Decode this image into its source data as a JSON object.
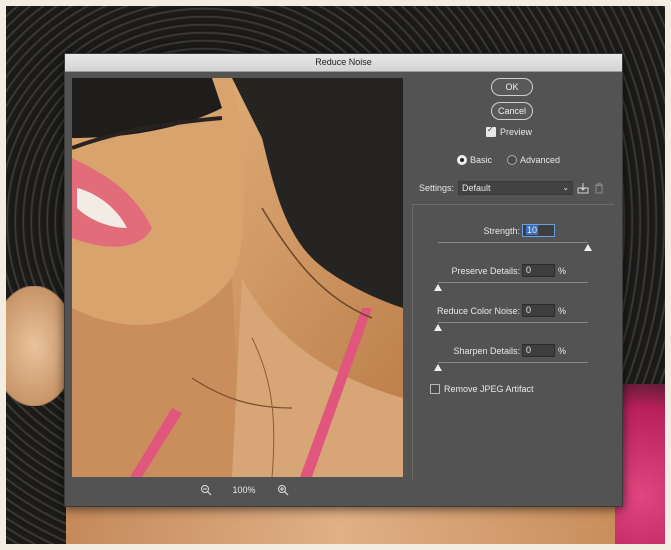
{
  "dialog": {
    "title": "Reduce Noise"
  },
  "buttons": {
    "ok": "OK",
    "cancel": "Cancel"
  },
  "preview_toggle": {
    "label": "Preview",
    "checked": true
  },
  "mode": {
    "basic": "Basic",
    "advanced": "Advanced",
    "selected": "basic"
  },
  "settings": {
    "label": "Settings:",
    "value": "Default"
  },
  "controls": [
    {
      "label": "Strength:",
      "value": "10",
      "unit": "",
      "level": 1.0
    },
    {
      "label": "Preserve Details:",
      "value": "0",
      "unit": "%",
      "level": 0
    },
    {
      "label": "Reduce Color Noise:",
      "value": "0",
      "unit": "%",
      "level": 0
    },
    {
      "label": "Sharpen Details:",
      "value": "0",
      "unit": "%",
      "level": 0
    }
  ],
  "jpeg_artifact": {
    "label": "Remove JPEG Artifact",
    "checked": false
  },
  "zoom": {
    "value": "100%"
  },
  "icons": [
    "zoom-out-icon",
    "zoom-in-icon",
    "save-preset-icon",
    "trash-icon",
    "chevron-down-icon"
  ],
  "colors": {
    "dialog_bg": "#535353",
    "titlebar": "#dcdcdc",
    "highlight": "#3b6fc0"
  }
}
